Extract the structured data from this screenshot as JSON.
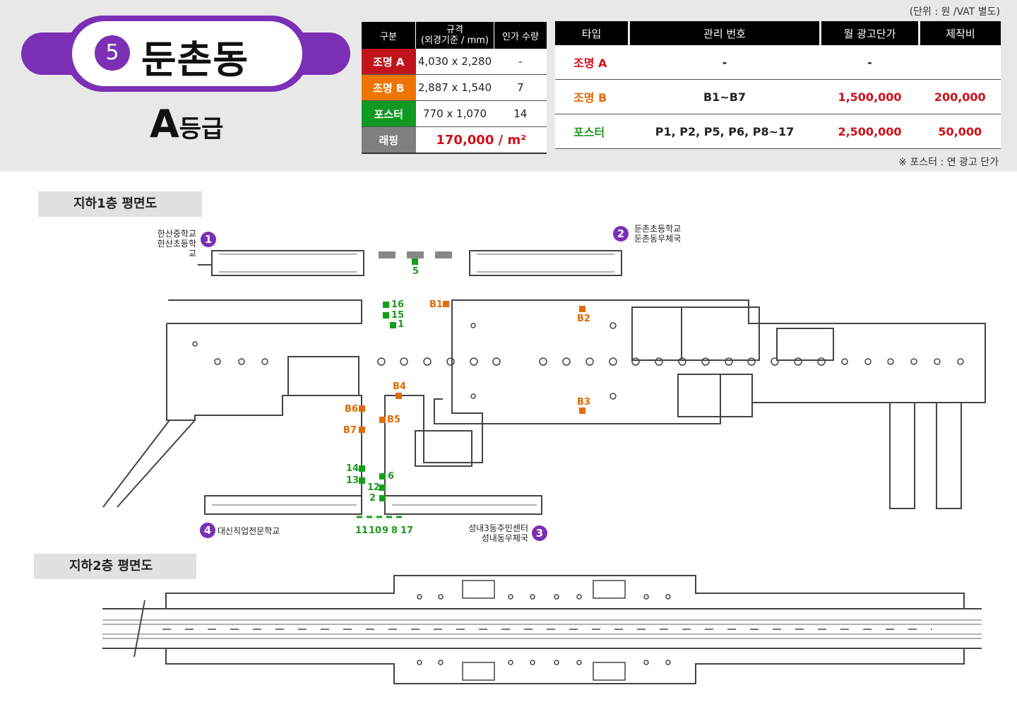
{
  "header": {
    "station_number": "5",
    "station_name": "둔촌동",
    "grade_letter": "A",
    "grade_suffix": "등급",
    "unit_note": "(단위 : 원 /VAT 별도)",
    "poster_note": "※ 포스터 : 연 광고 단가"
  },
  "spec_table": {
    "headers": [
      "구분",
      "규격",
      "(외경기준 / mm)",
      "인가 수량"
    ],
    "rows": [
      {
        "type": "조명 A",
        "size": "4,030 x 2,280",
        "qty": "-",
        "color": "#c0141c"
      },
      {
        "type": "조명 B",
        "size": "2,887 x 1,540",
        "qty": "7",
        "color": "#ee7600"
      },
      {
        "type": "포스터",
        "size": "770 x 1,070",
        "qty": "14",
        "color": "#119a21"
      }
    ],
    "wrapping": {
      "label": "래핑",
      "price": "170,000 / m²",
      "color": "#7f7f7f"
    }
  },
  "price_table": {
    "headers": [
      "타입",
      "관리 번호",
      "월 광고단가",
      "제작비"
    ],
    "rows": [
      {
        "type": "조명 A",
        "ids": "-",
        "monthly": "-",
        "production": ""
      },
      {
        "type": "조명 B",
        "ids": "B1~B7",
        "monthly": "1,500,000",
        "production": "200,000"
      },
      {
        "type": "포스터",
        "ids": "P1, P2, P5, P6, P8~17",
        "monthly": "2,500,000",
        "production": "50,000"
      }
    ]
  },
  "floor_b1": {
    "title": "지하1층 평면도",
    "exits": [
      {
        "num": "1",
        "line1": "한산중학교",
        "line2": "한산초등학교"
      },
      {
        "num": "2",
        "line1": "둔촌초등학교",
        "line2": "둔촌동우체국"
      },
      {
        "num": "3",
        "line1": "성내3동주민센터",
        "line2": "성내동우체국"
      },
      {
        "num": "4",
        "line1": "대신직업전문학교",
        "line2": ""
      }
    ],
    "orange_labels": [
      "B1",
      "B2",
      "B3",
      "B4",
      "B5",
      "B6",
      "B7"
    ],
    "green_labels": [
      "5",
      "16",
      "15",
      "1",
      "14",
      "13",
      "6",
      "12",
      "2",
      "11",
      "10",
      "9",
      "8",
      "17"
    ]
  },
  "floor_b2": {
    "title": "지하2층 평면도"
  },
  "colors": {
    "accent": "#7b2fb5",
    "orange": "#e36c0a",
    "green": "#12a01a"
  }
}
